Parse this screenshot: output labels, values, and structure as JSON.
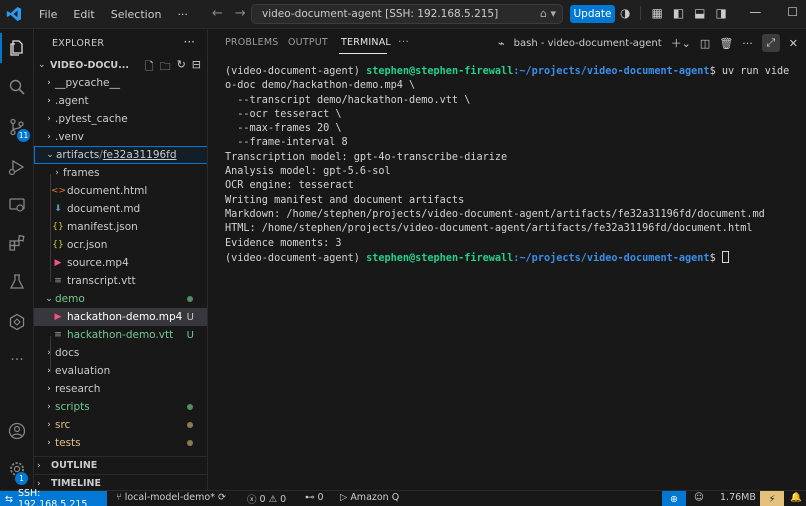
{
  "titlebar": {
    "menu": [
      "File",
      "Edit",
      "Selection",
      "···"
    ],
    "command_center": "video-document-agent [SSH: 192.168.5.215]",
    "update_label": "Update"
  },
  "activity_bar": {
    "items": [
      "explorer-icon",
      "search-icon",
      "source-control-icon",
      "run-debug-icon",
      "remote-explorer-icon",
      "extensions-icon",
      "testing-icon",
      "remote-icon",
      "more-icon"
    ],
    "scm_badge": "11",
    "settings_badge": "1"
  },
  "explorer": {
    "title": "EXPLORER",
    "more": "···",
    "folder": "VIDEO-DOCU...",
    "tree": [
      {
        "label": "__pycache__",
        "type": "folder",
        "depth": 1,
        "color": "#cccccc"
      },
      {
        "label": ".agent",
        "type": "folder",
        "depth": 1,
        "color": "#cccccc"
      },
      {
        "label": ".pytest_cache",
        "type": "folder",
        "depth": 1,
        "color": "#cccccc"
      },
      {
        "label": ".venv",
        "type": "folder",
        "depth": 1,
        "color": "#cccccc"
      },
      {
        "label": "artifacts",
        "sublabel": "fe32a31196fd",
        "type": "folder-open",
        "depth": 1,
        "color": "#cccccc"
      },
      {
        "label": "frames",
        "type": "folder",
        "depth": 2,
        "color": "#cccccc"
      },
      {
        "label": "document.html",
        "type": "html",
        "depth": 2,
        "color": "#cccccc"
      },
      {
        "label": "document.md",
        "type": "md",
        "depth": 2,
        "color": "#cccccc"
      },
      {
        "label": "manifest.json",
        "type": "json",
        "depth": 2,
        "color": "#cccccc"
      },
      {
        "label": "ocr.json",
        "type": "json",
        "depth": 2,
        "color": "#cccccc"
      },
      {
        "label": "source.mp4",
        "type": "mp4",
        "depth": 2,
        "color": "#cccccc"
      },
      {
        "label": "transcript.vtt",
        "type": "vtt",
        "depth": 2,
        "color": "#cccccc"
      },
      {
        "label": "demo",
        "type": "folder-open",
        "depth": 1,
        "color": "#73c991",
        "marker": "dot"
      },
      {
        "label": "hackathon-demo.mp4",
        "type": "mp4",
        "depth": 2,
        "color": "#ffffff",
        "status": "U"
      },
      {
        "label": "hackathon-demo.vtt",
        "type": "vtt",
        "depth": 2,
        "color": "#73c991",
        "status": "U"
      },
      {
        "label": "docs",
        "type": "folder",
        "depth": 1,
        "color": "#cccccc"
      },
      {
        "label": "evaluation",
        "type": "folder",
        "depth": 1,
        "color": "#cccccc"
      },
      {
        "label": "research",
        "type": "folder",
        "depth": 1,
        "color": "#cccccc"
      },
      {
        "label": "scripts",
        "type": "folder",
        "depth": 1,
        "color": "#73c991",
        "marker": "dot"
      },
      {
        "label": "src",
        "type": "folder",
        "depth": 1,
        "color": "#e2c08d",
        "marker": "dot-brown"
      },
      {
        "label": "tests",
        "type": "folder",
        "depth": 1,
        "color": "#e2c08d",
        "marker": "dot-brown"
      }
    ],
    "sections": [
      "OUTLINE",
      "TIMELINE"
    ]
  },
  "panel": {
    "tabs": [
      "PROBLEMS",
      "OUTPUT",
      "TERMINAL",
      "···"
    ],
    "active_tab": "TERMINAL",
    "terminal_name": "bash - video-document-agent"
  },
  "terminal": {
    "env": "(video-document-agent) ",
    "user": "stephen@stephen-firewall",
    "path": ":~/projects/video-document-agent",
    "prompt_end": "$ ",
    "command_first": "uv run vide",
    "lines": [
      "o-doc demo/hackathon-demo.mp4 \\",
      "  --transcript demo/hackathon-demo.vtt \\",
      "  --ocr tesseract \\",
      "  --max-frames 20 \\",
      "  --frame-interval 8",
      "Transcription model: gpt-4o-transcribe-diarize",
      "Analysis model: gpt-5.6-sol",
      "OCR engine: tesseract",
      "Writing manifest and document artifacts",
      "Markdown: /home/stephen/projects/video-document-agent/artifacts/fe32a31196fd/document.md",
      "HTML: /home/stephen/projects/video-document-agent/artifacts/fe32a31196fd/document.html",
      "Evidence moments: 3"
    ]
  },
  "statusbar": {
    "remote": "SSH: 192.168.5.215",
    "branch": "local-model-demo*",
    "errors": "0",
    "warnings": "0",
    "ports": "0",
    "amazon_q": "Amazon Q",
    "memory": "1.76MB"
  },
  "colors": {
    "accent": "#0078d4",
    "git_added": "#73c991",
    "git_modified": "#e2c08d",
    "terminal_user": "#23d18b",
    "terminal_path": "#3b8eea"
  }
}
